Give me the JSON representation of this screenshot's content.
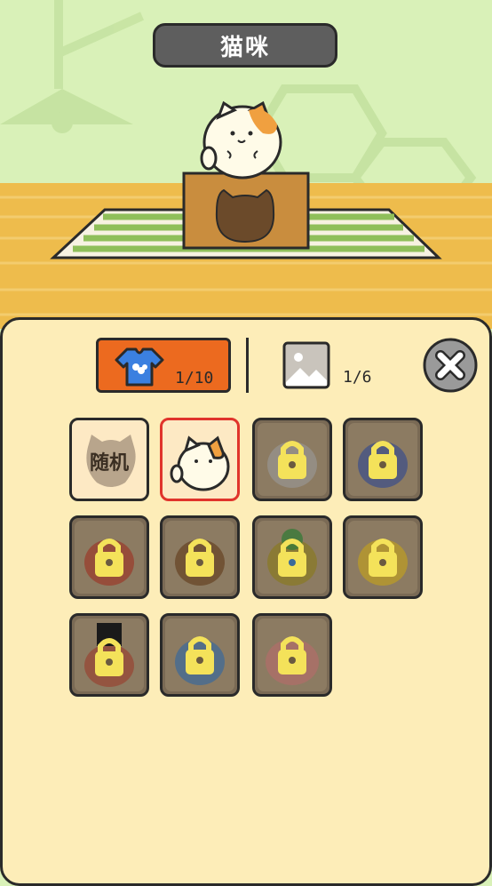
{
  "header": {
    "title": "猫咪"
  },
  "tabs": {
    "outfits": {
      "icon": "tshirt-icon",
      "count": "1/10"
    },
    "backgrounds": {
      "icon": "picture-icon",
      "count": "1/6"
    }
  },
  "close": {
    "icon": "close-icon"
  },
  "grid": {
    "random_label": "随机",
    "items": [
      {
        "name": "random",
        "state": "unlocked"
      },
      {
        "name": "calico-cat",
        "state": "selected"
      },
      {
        "name": "robot-cat",
        "state": "locked"
      },
      {
        "name": "dragon-cat",
        "state": "locked"
      },
      {
        "name": "red-cat",
        "state": "locked"
      },
      {
        "name": "detective-cat",
        "state": "locked"
      },
      {
        "name": "frog-cat",
        "state": "locked"
      },
      {
        "name": "bee-cat",
        "state": "locked"
      },
      {
        "name": "hat-cat",
        "state": "locked"
      },
      {
        "name": "builder-cat",
        "state": "locked"
      },
      {
        "name": "flower-cat",
        "state": "locked"
      }
    ]
  },
  "colors": {
    "wall": "#d9f1b8",
    "floor": "#eebc4c",
    "panel": "#fdedb8",
    "accent": "#ec6a1f",
    "selected_border": "#e0342c",
    "lock": "#f4e25a"
  }
}
